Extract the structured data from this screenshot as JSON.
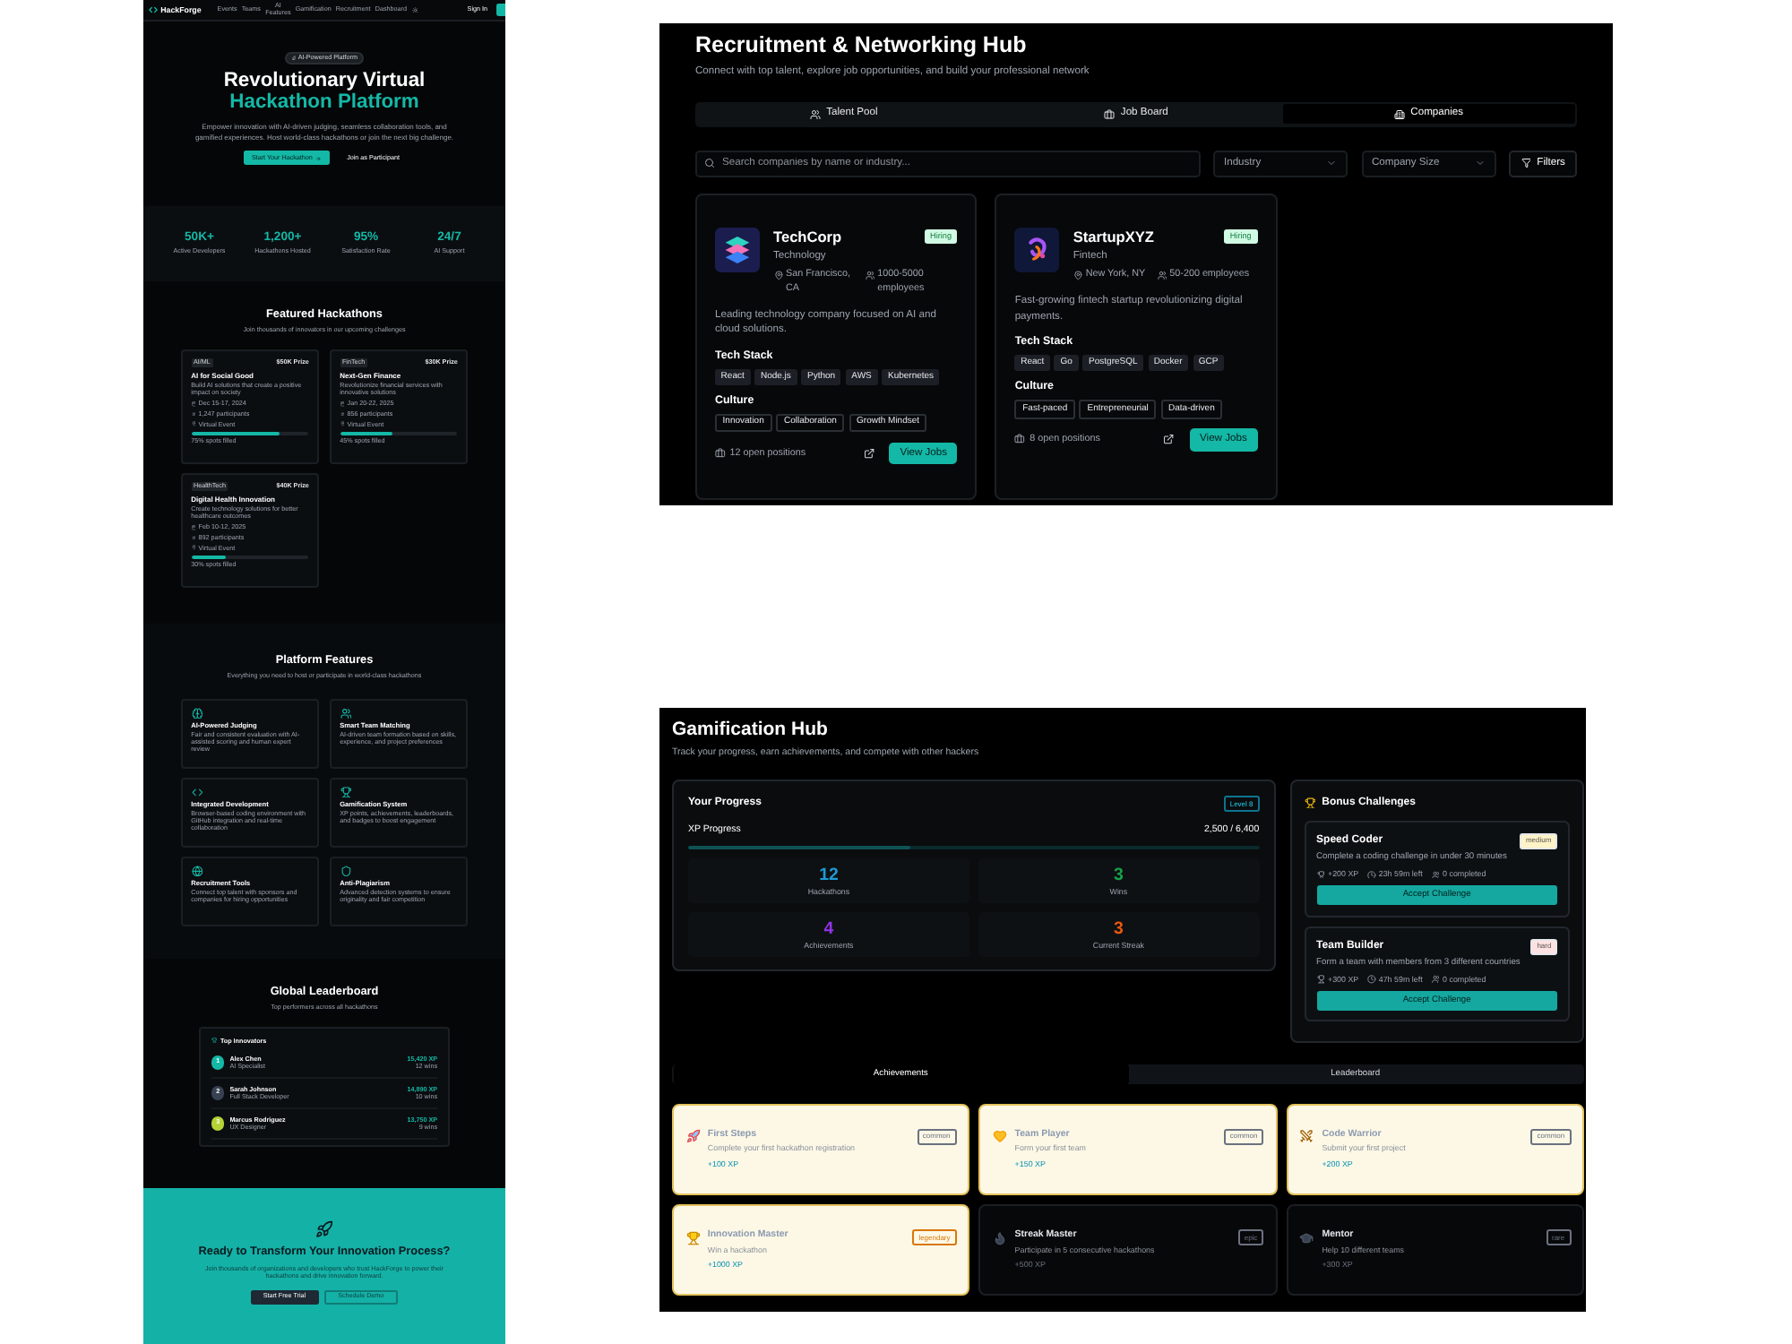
{
  "landing_page": {
    "nav": {
      "logo": "HackForge",
      "links": [
        "Events",
        "Teams",
        "AI Features",
        "Gamification",
        "Recruitment",
        "Dashboard"
      ],
      "sign_in": "Sign In"
    },
    "hero": {
      "badge": "AI-Powered Platform",
      "title_line_1": "Revolutionary Virtual",
      "title_line_2": "Hackathon Platform",
      "description": "Empower innovation with AI-driven judging, seamless collaboration tools, and gamified experiences. Host world-class hackathons or join the next big challenge.",
      "primary_button": "Start Your Hackathon",
      "secondary_button": "Join as Participant"
    },
    "stats": [
      {
        "value": "50K+",
        "label": "Active Developers"
      },
      {
        "value": "1,200+",
        "label": "Hackathons Hosted"
      },
      {
        "value": "95%",
        "label": "Satisfaction Rate"
      },
      {
        "value": "24/7",
        "label": "AI Support"
      }
    ],
    "featured": {
      "title": "Featured Hackathons",
      "subtitle": "Join thousands of innovators in our upcoming challenges",
      "cards": [
        {
          "tag": "AI/ML",
          "prize": "$50K Prize",
          "title": "AI for Social Good",
          "description": "Build AI solutions that create a positive impact on society",
          "date": "Dec 15-17, 2024",
          "participants": "1,247 participants",
          "location": "Virtual Event",
          "level": 0.75,
          "filled": "75% spots filled"
        },
        {
          "tag": "FinTech",
          "prize": "$30K Prize",
          "title": "Next-Gen Finance",
          "description": "Revolutionize financial services with innovative solutions",
          "date": "Jan 20-22, 2025",
          "participants": "856 participants",
          "location": "Virtual Event",
          "level": 0.45,
          "filled": "45% spots filled"
        },
        {
          "tag": "HealthTech",
          "prize": "$40K Prize",
          "title": "Digital Health Innovation",
          "description": "Create technology solutions for better healthcare outcomes",
          "date": "Feb 10-12, 2025",
          "participants": "892 participants",
          "location": "Virtual Event",
          "level": 0.3,
          "filled": "30% spots filled"
        }
      ]
    },
    "features": {
      "title": "Platform Features",
      "subtitle": "Everything you need to host or participate in world-class hackathons",
      "items": [
        {
          "title": "AI-Powered Judging",
          "description": "Fair and consistent evaluation with AI-assisted scoring and human expert review"
        },
        {
          "title": "Smart Team Matching",
          "description": "AI-driven team formation based on skills, experience, and project preferences"
        },
        {
          "title": "Integrated Development",
          "description": "Browser-based coding environment with GitHub integration and real-time collaboration"
        },
        {
          "title": "Gamification System",
          "description": "XP points, achievements, leaderboards, and badges to boost engagement"
        },
        {
          "title": "Recruitment Tools",
          "description": "Connect top talent with sponsors and companies for hiring opportunities"
        },
        {
          "title": "Anti-Plagiarism",
          "description": "Advanced detection systems to ensure originality and fair competition"
        }
      ]
    },
    "leaderboard": {
      "title": "Global Leaderboard",
      "subtitle": "Top performers across all hackathons",
      "card_title": "Top Innovators",
      "rows": [
        {
          "rank": "1",
          "color": "#14b8a6",
          "name": "Alex Chen",
          "role": "AI Specialist",
          "xp": "15,420 XP",
          "wins": "12 wins"
        },
        {
          "rank": "2",
          "color": "#374151",
          "name": "Sarah Johnson",
          "role": "Full Stack Developer",
          "xp": "14,890 XP",
          "wins": "10 wins"
        },
        {
          "rank": "3",
          "color": "#b5d335",
          "name": "Marcus Rodriguez",
          "role": "UX Designer",
          "xp": "13,750 XP",
          "wins": "9 wins"
        }
      ]
    },
    "cta": {
      "title": "Ready to Transform Your Innovation Process?",
      "description": "Join thousands of organizations and developers who trust HackForge to power their hackathons and drive innovation forward.",
      "primary_button": "Start Free Trial",
      "secondary_button": "Schedule Demo"
    }
  },
  "recruitment_hub": {
    "title": "Recruitment & Networking Hub",
    "subtitle": "Connect with top talent, explore job opportunities, and build your professional network",
    "tabs": [
      {
        "label": "Talent Pool",
        "selected": false
      },
      {
        "label": "Job Board",
        "selected": false
      },
      {
        "label": "Companies",
        "selected": true
      }
    ],
    "search": {
      "placeholder": "Search companies by name or industry..."
    },
    "filters": [
      {
        "label": "Industry"
      },
      {
        "label": "Company Size"
      }
    ],
    "filter_button": "Filters",
    "companies": [
      {
        "name": "TechCorp",
        "status": "Hiring",
        "industry": "Technology",
        "location": "San Francisco, CA",
        "size": "1000-5000 employees",
        "description": "Leading technology company focused on AI and cloud solutions.",
        "tech_stack_label": "Tech Stack",
        "tech_stack": [
          "React",
          "Node.js",
          "Python",
          "AWS",
          "Kubernetes"
        ],
        "culture_label": "Culture",
        "culture": [
          "Innovation",
          "Collaboration",
          "Growth Mindset"
        ],
        "open_positions": "12 open positions",
        "button": "View Jobs"
      },
      {
        "name": "StartupXYZ",
        "status": "Hiring",
        "industry": "Fintech",
        "location": "New York, NY",
        "size": "50-200 employees",
        "description": "Fast-growing fintech startup revolutionizing digital payments.",
        "tech_stack_label": "Tech Stack",
        "tech_stack": [
          "React",
          "Go",
          "PostgreSQL",
          "Docker",
          "GCP"
        ],
        "culture_label": "Culture",
        "culture": [
          "Fast-paced",
          "Entrepreneurial",
          "Data-driven"
        ],
        "open_positions": "8 open positions",
        "button": "View Jobs"
      }
    ]
  },
  "gamification_hub": {
    "title": "Gamification Hub",
    "subtitle": "Track your progress, earn achievements, and compete with other hackers",
    "progress": {
      "title": "Your Progress",
      "badge": "Level 8",
      "xp_label": "XP Progress",
      "xp_reading": "2,500 / 6,400",
      "level": 0.39,
      "stats": [
        {
          "value": "12",
          "label": "Hackathons",
          "color": "#1d9bd6"
        },
        {
          "value": "3",
          "label": "Wins",
          "color": "#16a34a"
        },
        {
          "value": "4",
          "label": "Achievements",
          "color": "#9333ea"
        },
        {
          "value": "3",
          "label": "Current Streak",
          "color": "#ea580c"
        }
      ]
    },
    "bonus": {
      "title": "Bonus Challenges",
      "challenges": [
        {
          "title": "Speed Coder",
          "difficulty": {
            "label": "medium",
            "color": "#fef3c7"
          },
          "description": "Complete a coding challenge in under 30 minutes",
          "reward": "+200 XP",
          "time_left": "23h 59m left",
          "completed": "0 completed",
          "button": "Accept Challenge"
        },
        {
          "title": "Team Builder",
          "difficulty": {
            "label": "hard",
            "color": "#fee2e2"
          },
          "description": "Form a team with members from 3 different countries",
          "reward": "+300 XP",
          "time_left": "47h 59m left",
          "completed": "0 completed",
          "button": "Accept Challenge"
        }
      ]
    },
    "tabs": [
      {
        "label": "Achievements",
        "selected": true
      },
      {
        "label": "Leaderboard",
        "selected": false
      }
    ],
    "achievements": [
      {
        "title": "First Steps",
        "description": "Complete your first hackathon registration",
        "xp": "+100 XP",
        "unlocked": true,
        "badge": {
          "label": "common",
          "color": "#6b7280"
        }
      },
      {
        "title": "Team Player",
        "description": "Form your first team",
        "xp": "+150 XP",
        "unlocked": true,
        "badge": {
          "label": "common",
          "color": "#6b7280"
        }
      },
      {
        "title": "Code Warrior",
        "description": "Submit your first project",
        "xp": "+200 XP",
        "unlocked": true,
        "badge": {
          "label": "common",
          "color": "#6b7280"
        }
      },
      {
        "title": "Innovation Master",
        "description": "Win a hackathon",
        "xp": "+1000 XP",
        "unlocked": true,
        "badge": {
          "label": "legendary",
          "color": "#d97706"
        }
      },
      {
        "title": "Streak Master",
        "description": "Participate in 5 consecutive hackathons",
        "xp": "+500 XP",
        "unlocked": false,
        "badge": {
          "label": "epic",
          "color": "#6b7280"
        }
      },
      {
        "title": "Mentor",
        "description": "Help 10 different teams",
        "xp": "+300 XP",
        "unlocked": false,
        "badge": {
          "label": "rare",
          "color": "#6b7280"
        }
      }
    ]
  }
}
